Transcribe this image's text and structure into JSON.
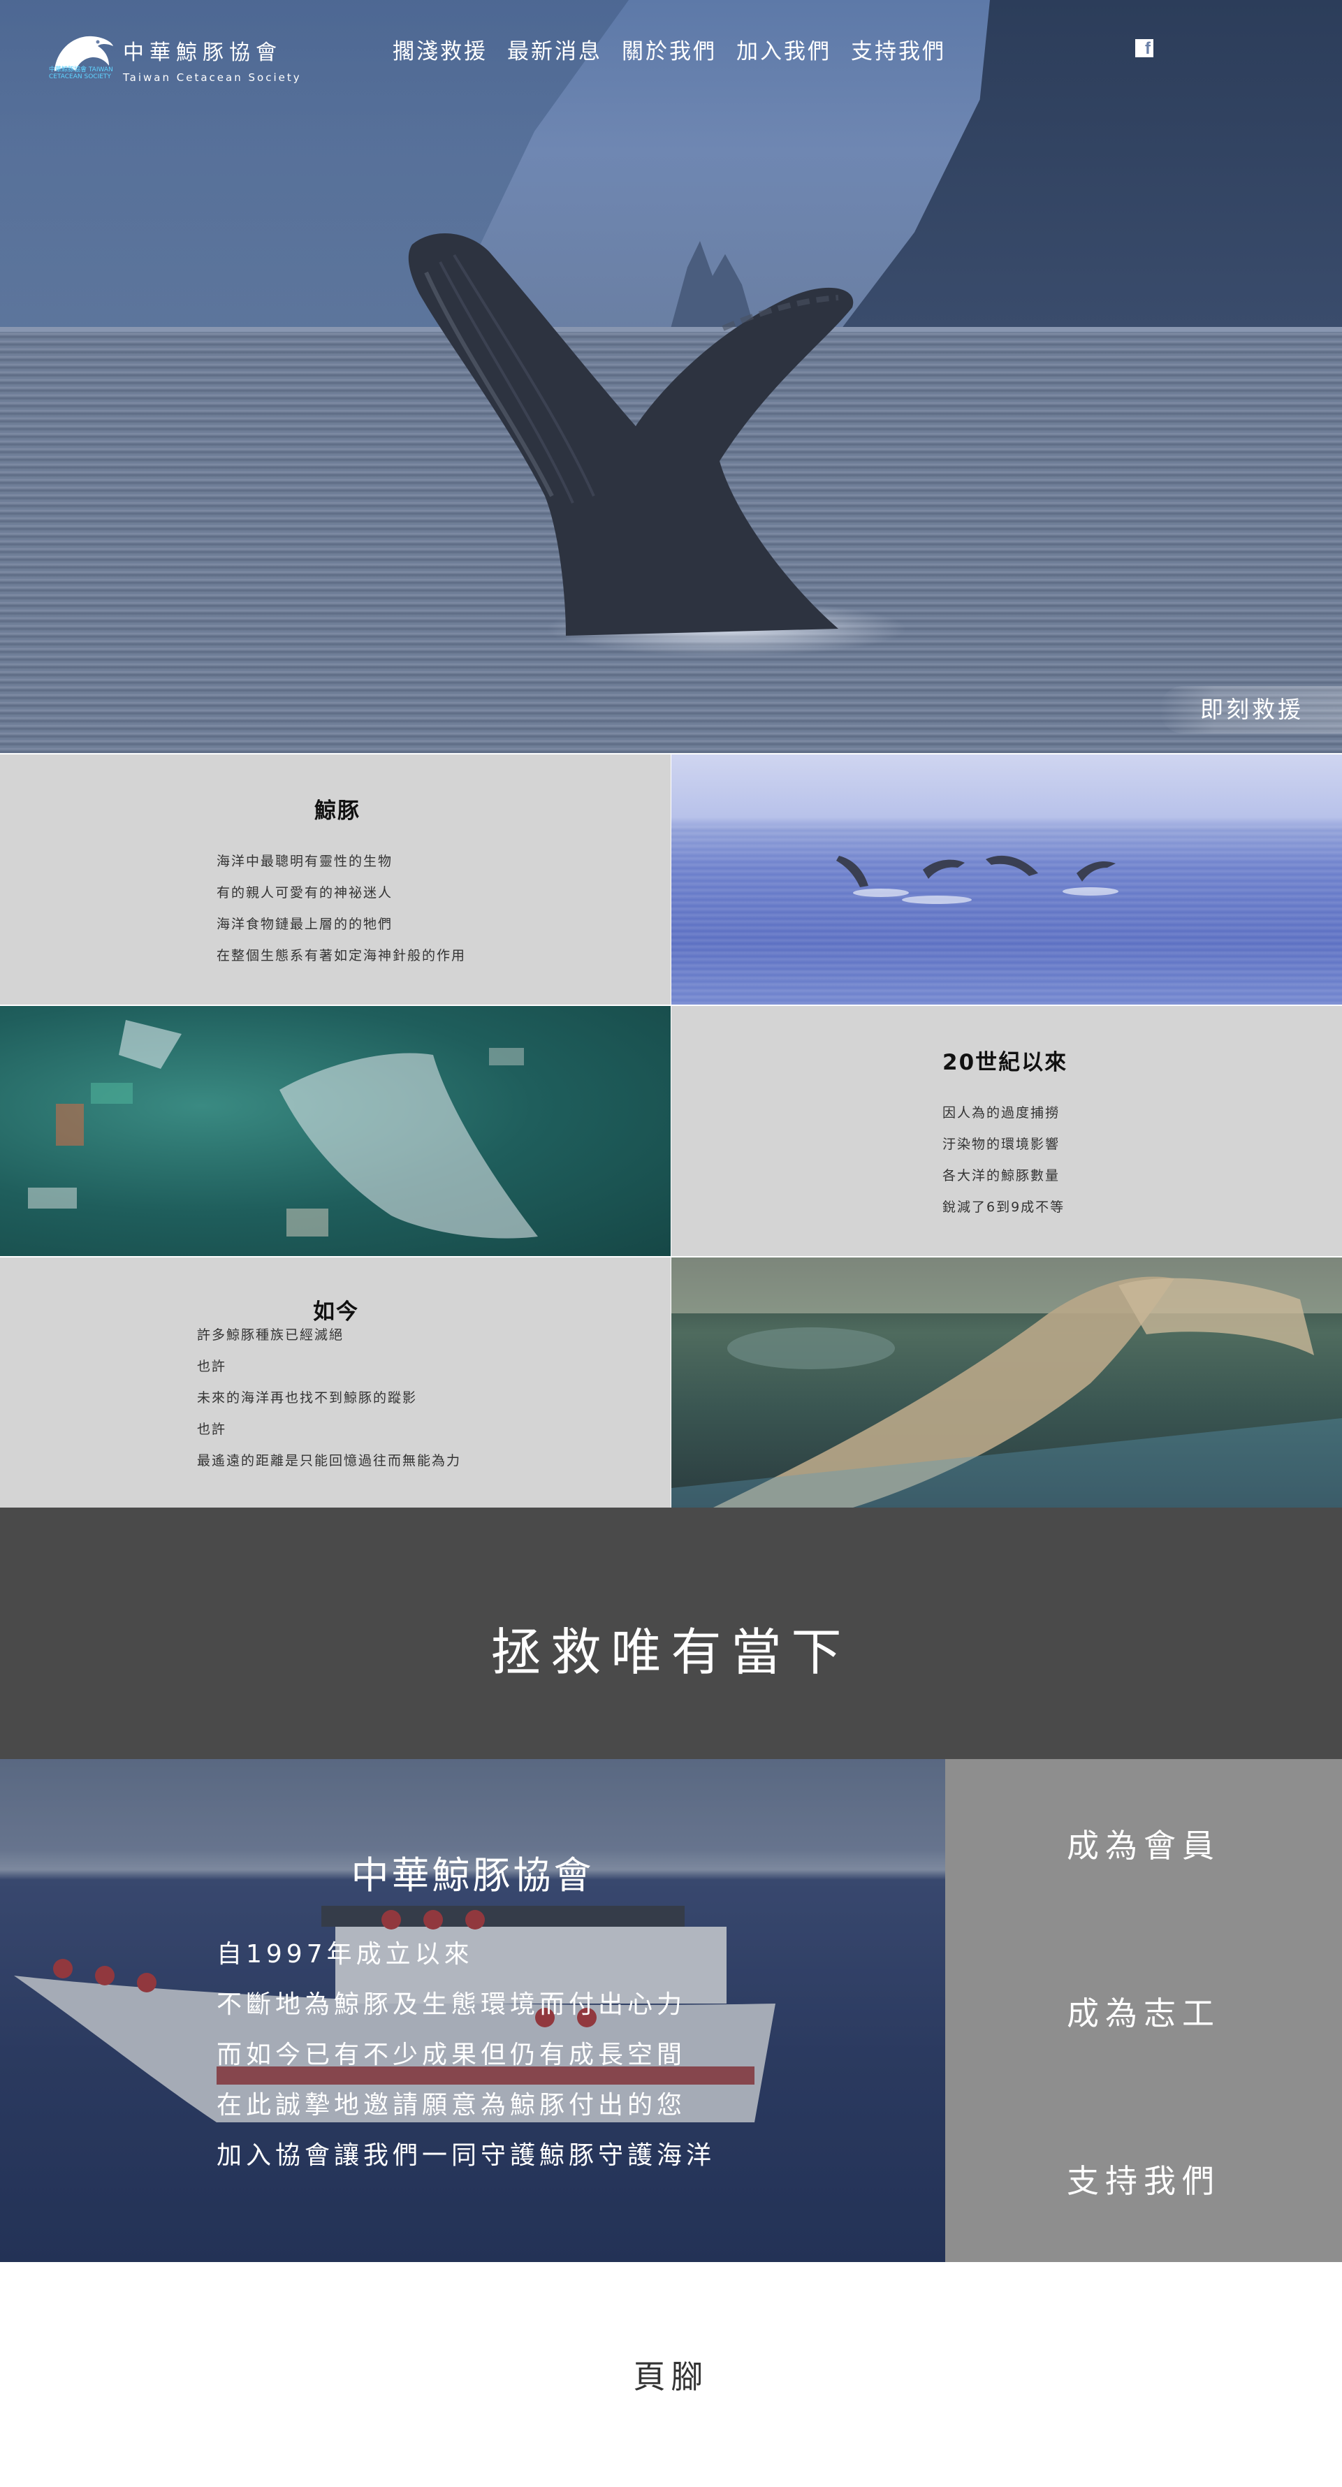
{
  "header": {
    "logo_title": "中華鯨豚協會",
    "logo_subtitle": "Taiwan Cetacean Society",
    "logo_tiny": "中華鯨豚協會 TAIWAN CETACEAN SOCIETY",
    "nav": [
      "擱淺救援",
      "最新消息",
      "關於我們",
      "加入我們",
      "支持我們"
    ],
    "social_icon": "facebook-icon",
    "social_glyph": "f"
  },
  "hero": {
    "cta_label": "即刻救援"
  },
  "sections": {
    "cetacean": {
      "title": "鯨豚",
      "lines": [
        "海洋中最聰明有靈性的生物",
        "有的親人可愛有的神祕迷人",
        "海洋食物鏈最上層的的牠們",
        "在整個生態系有著如定海神針般的作用"
      ]
    },
    "century": {
      "title": "20世紀以來",
      "lines": [
        "因人為的過度捕撈",
        "汙染物的環境影響",
        "各大洋的鯨豚數量",
        "銳減了6到9成不等"
      ]
    },
    "today": {
      "title": "如今",
      "lines": [
        "許多鯨豚種族已經滅絕",
        "也許",
        "未來的海洋再也找不到鯨豚的蹤影",
        "也許",
        "最遙遠的距離是只能回憶過往而無能為力"
      ]
    }
  },
  "banner": {
    "text": "拯救唯有當下"
  },
  "about": {
    "title": "中華鯨豚協會",
    "lines": [
      "自1997年成立以來",
      "不斷地為鯨豚及生態環境而付出心力",
      "而如今已有不少成果但仍有成長空間",
      "在此誠摯地邀請願意為鯨豚付出的您",
      "加入協會讓我們一同守護鯨豚守護海洋"
    ]
  },
  "actions": [
    "成為會員",
    "成為志工",
    "支持我們"
  ],
  "footer": {
    "text": "頁腳"
  },
  "colors": {
    "text_panel": "#d4d4d4",
    "banner": "#4a4a4a",
    "side_panel": "#8e8e8e",
    "accent_logo": "#5fd3ff"
  }
}
